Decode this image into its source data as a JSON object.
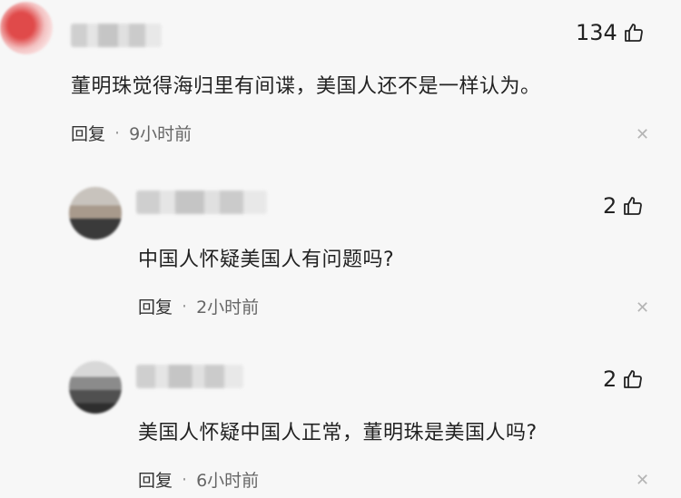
{
  "comments": [
    {
      "likes": "134",
      "text": "董明珠觉得海归里有间谍，美国人还不是一样认为。",
      "reply": "回复",
      "sep": "·",
      "time": "9小时前"
    },
    {
      "likes": "2",
      "text": "中国人怀疑美国人有问题吗?",
      "reply": "回复",
      "sep": "·",
      "time": "2小时前"
    },
    {
      "likes": "2",
      "text": "美国人怀疑中国人正常，董明珠是美国人吗?",
      "reply": "回复",
      "sep": "·",
      "time": "6小时前"
    }
  ],
  "icons": {
    "like": "thumbs-up-icon",
    "close": "close-icon"
  }
}
